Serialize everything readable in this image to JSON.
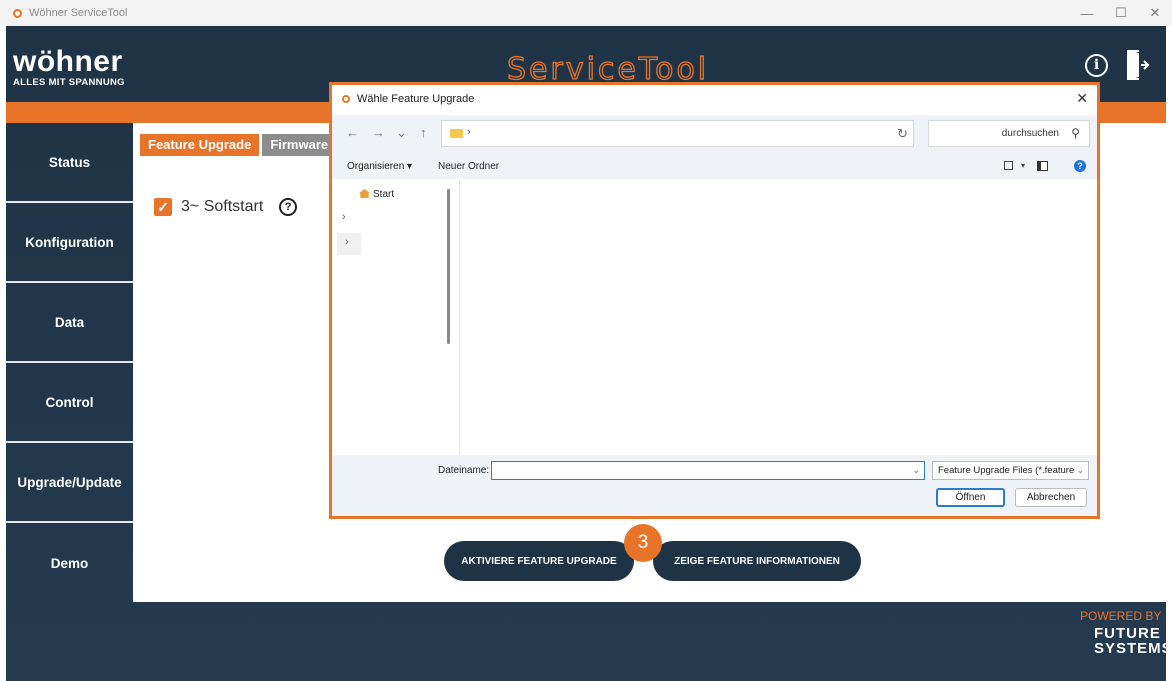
{
  "window": {
    "title": "Wöhner ServiceTool",
    "controls": [
      "—",
      "☐",
      "✕"
    ]
  },
  "header": {
    "brand": "wöhner",
    "tagline": "ALLES MIT SPANNUNG",
    "app_title": "ServiceTool",
    "info_label": "i"
  },
  "sidebar": {
    "items": [
      {
        "label": "Status"
      },
      {
        "label": "Konfiguration"
      },
      {
        "label": "Data"
      },
      {
        "label": "Control"
      },
      {
        "label": "Upgrade/Update"
      },
      {
        "label": "Demo"
      }
    ]
  },
  "tabs": [
    {
      "label": "Feature Upgrade",
      "active": true
    },
    {
      "label": "Firmware",
      "active": false
    }
  ],
  "feature": {
    "check": "✓",
    "label": "3~ Softstart",
    "help": "?"
  },
  "buttons": {
    "activate": "AKTIVIERE FEATURE UPGRADE",
    "info": "ZEIGE FEATURE INFORMATIONEN"
  },
  "step_badge": "3",
  "footer": {
    "powered": "POWERED BY",
    "future_line1": "FUTURE",
    "future_line2": "SYSTEMS"
  },
  "dialog": {
    "title": "Wähle Feature Upgrade",
    "close": "✕",
    "nav": {
      "back": "←",
      "forward": "→",
      "history": "⌄",
      "up": "↑",
      "caret": "›",
      "dropdown": "⌄",
      "refresh": "↻"
    },
    "search_placeholder": "durchsuchen",
    "search_icon": "⚲",
    "organize": "Organisieren ▾",
    "new_folder": "Neuer Ordner",
    "view_dropdown": "▾",
    "help": "?",
    "nav_pane": {
      "start": "Start",
      "chevron1": "›",
      "chevron2": "›"
    },
    "filename_label": "Dateiname:",
    "filename_value": "",
    "filename_dropdown": "⌄",
    "filter": "Feature Upgrade Files (*.feature",
    "filter_dropdown": "⌄",
    "open": "Öffnen",
    "cancel": "Abbrechen"
  },
  "colors": {
    "accent": "#e8742a",
    "navy": "#1f3346",
    "link_blue": "#2b7bd0"
  }
}
